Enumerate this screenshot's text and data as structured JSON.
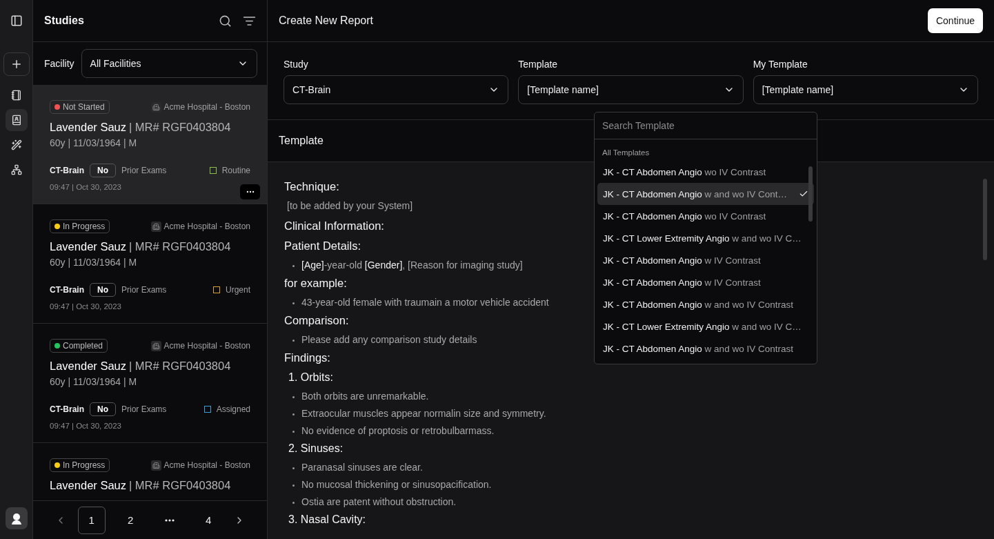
{
  "rail": {
    "items": [
      {
        "kind": "notebook",
        "selected": false
      },
      {
        "kind": "contacts",
        "selected": true
      },
      {
        "kind": "wand",
        "selected": false
      },
      {
        "kind": "network",
        "selected": false
      }
    ]
  },
  "studies": {
    "title": "Studies",
    "facility_label": "Facility",
    "facility_value": "All Facilities",
    "cards": [
      {
        "status": {
          "label": "Not Started",
          "color": "#f05252"
        },
        "facility": "Acme Hospital - Boston",
        "name": "Lavender Sauz",
        "mr": "| MR# RGF0403804",
        "demographics": "60y | 11/03/1964 | M",
        "study": "CT-Brain",
        "prior": "No",
        "prior_label": "Prior Exams",
        "priority": {
          "label": "Routine",
          "color": "#8bc34a"
        },
        "time": "09:47 | Oct 30, 2023",
        "selected": true
      },
      {
        "status": {
          "label": "In Progress",
          "color": "#facc15"
        },
        "facility": "Acme Hospital - Boston",
        "name": "Lavender Sauz",
        "mr": "| MR# RGF0403804",
        "demographics": "60y | 11/03/1964 | M",
        "study": "CT-Brain",
        "prior": "No",
        "prior_label": "Prior Exams",
        "priority": {
          "label": "Urgent",
          "color": "#d4a72c"
        },
        "time": "09:47 | Oct 30, 2023",
        "selected": false
      },
      {
        "status": {
          "label": "Completed",
          "color": "#22c55e"
        },
        "facility": "Acme Hospital - Boston",
        "name": "Lavender Sauz",
        "mr": "| MR# RGF0403804",
        "demographics": "60y | 11/03/1964 | M",
        "study": "CT-Brain",
        "prior": "No",
        "prior_label": "Prior Exams",
        "priority": {
          "label": "Assigned",
          "color": "#3b9fd8"
        },
        "time": "09:47 | Oct 30, 2023",
        "selected": false
      },
      {
        "status": {
          "label": "In Progress",
          "color": "#facc15"
        },
        "facility": "Acme Hospital - Boston",
        "name": "Lavender Sauz",
        "mr": "| MR# RGF0403804",
        "selected": false
      }
    ],
    "pages": [
      {
        "kind": "page",
        "label": "1",
        "selected": true
      },
      {
        "kind": "page",
        "label": "2",
        "selected": false
      },
      {
        "kind": "ellipsis",
        "selected": false
      },
      {
        "kind": "page",
        "label": "4",
        "selected": false
      }
    ]
  },
  "header": {
    "title": "Create New Report",
    "button": "Continue"
  },
  "selects": [
    {
      "label": "Study",
      "value": "CT-Brain"
    },
    {
      "label": "Template",
      "value": "[Template name]"
    },
    {
      "label": "My Template",
      "value": "[Template name]"
    }
  ],
  "template_heading": "Template",
  "dropdown": {
    "placeholder": "Search Template",
    "group": "All Templates",
    "items": [
      {
        "name": "JK - CT Abdomen Angio",
        "rest": "wo IV Contrast",
        "selected": false
      },
      {
        "name": "JK - CT Abdomen Angio",
        "rest": "w and wo IV Cont…",
        "selected": true
      },
      {
        "name": "JK - CT Abdomen Angio",
        "rest": "wo IV Contrast",
        "selected": false
      },
      {
        "name": "JK - CT Lower Extremity Angio",
        "rest": "w and wo IV C…",
        "selected": false
      },
      {
        "name": "JK - CT Abdomen Angio",
        "rest": "w IV Contrast",
        "selected": false
      },
      {
        "name": "JK - CT Abdomen Angio",
        "rest": "w IV Contrast",
        "selected": false
      },
      {
        "name": "JK - CT Abdomen Angio",
        "rest": "w and wo IV Contrast",
        "selected": false
      },
      {
        "name": "JK - CT Lower Extremity Angio",
        "rest": "w and wo IV C…",
        "selected": false
      },
      {
        "name": "JK - CT Abdomen Angio",
        "rest": "w and wo IV Contrast",
        "selected": false
      }
    ]
  },
  "report": [
    {
      "kind": "heading",
      "text": "Technique:"
    },
    {
      "kind": "note",
      "text": "[to be added by your System]"
    },
    {
      "kind": "heading",
      "text": "Clinical Information:"
    },
    {
      "kind": "heading",
      "text": "Patient Details:"
    },
    {
      "kind": "bullet",
      "text": "**[Age]**-year-old **[Gender]**, [Reason for imaging study]"
    },
    {
      "kind": "heading",
      "text": "for example:"
    },
    {
      "kind": "bullet",
      "text": "43-year-old female with traumain a motor vehicle accident"
    },
    {
      "kind": "heading",
      "text": "Comparison:"
    },
    {
      "kind": "bullet",
      "text": "Please add any comparison study details"
    },
    {
      "kind": "heading",
      "text": "Findings:"
    },
    {
      "kind": "numbered",
      "text": "1. Orbits:"
    },
    {
      "kind": "bullet",
      "text": "Both orbits are unremarkable."
    },
    {
      "kind": "bullet",
      "text": "Extraocular muscles appear normalin size and symmetry."
    },
    {
      "kind": "bullet",
      "text": "No evidence of proptosis or retrobulbarmass."
    },
    {
      "kind": "numbered",
      "text": "2. Sinuses:"
    },
    {
      "kind": "bullet",
      "text": "Paranasal sinuses are clear."
    },
    {
      "kind": "bullet",
      "text": "No mucosal thickening or sinusopacification."
    },
    {
      "kind": "bullet",
      "text": "Ostia are patent without obstruction."
    },
    {
      "kind": "numbered",
      "text": "3. Nasal Cavity:"
    }
  ]
}
